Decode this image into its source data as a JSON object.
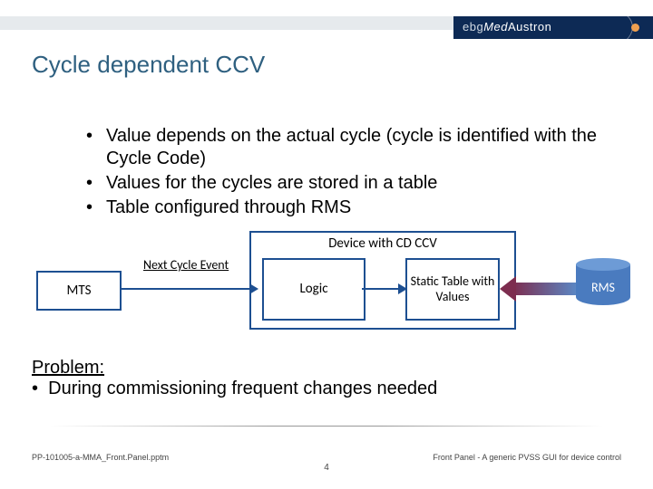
{
  "header": {
    "logo_prefix": "ebg",
    "logo_italic": "Med",
    "logo_rest": "Austron"
  },
  "title": "Cycle dependent CCV",
  "bullets": [
    "Value depends on the actual cycle (cycle is identified with the Cycle Code)",
    "Values for the cycles are stored in a table",
    "Table configured through RMS"
  ],
  "diagram": {
    "mts": "MTS",
    "next_cycle": "Next Cycle Event",
    "device_label": "Device with CD CCV",
    "logic": "Logic",
    "static": "Static Table with Values",
    "rms": "RMS"
  },
  "problem": {
    "heading": "Problem:",
    "line": "During commissioning frequent changes needed"
  },
  "footer": {
    "left": "PP-101005-a-MMA_Front.Panel.pptm",
    "right": "Front Panel - A generic PVSS GUI for device control",
    "page": "4"
  }
}
